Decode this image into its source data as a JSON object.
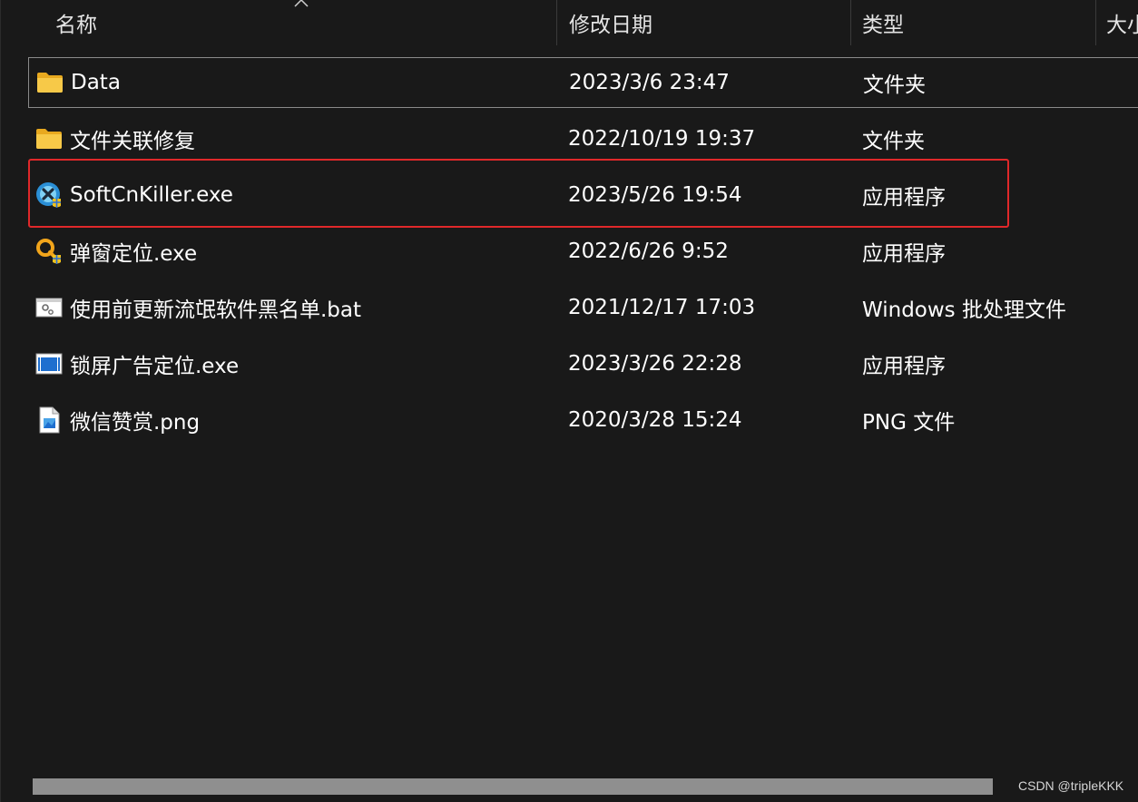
{
  "columns": {
    "name": "名称",
    "modified": "修改日期",
    "type": "类型",
    "size": "大小"
  },
  "files": [
    {
      "name": "Data",
      "modified": "2023/3/6 23:47",
      "type": "文件夹",
      "icon": "folder-icon"
    },
    {
      "name": "文件关联修复",
      "modified": "2022/10/19 19:37",
      "type": "文件夹",
      "icon": "folder-icon"
    },
    {
      "name": "SoftCnKiller.exe",
      "modified": "2023/5/26 19:54",
      "type": "应用程序",
      "icon": "softcnkiller-app-icon"
    },
    {
      "name": "弹窗定位.exe",
      "modified": "2022/6/26 9:52",
      "type": "应用程序",
      "icon": "popup-locator-app-icon"
    },
    {
      "name": "使用前更新流氓软件黑名单.bat",
      "modified": "2021/12/17 17:03",
      "type": "Windows 批处理文件",
      "icon": "batch-file-icon"
    },
    {
      "name": "锁屏广告定位.exe",
      "modified": "2023/3/26 22:28",
      "type": "应用程序",
      "icon": "window-app-icon"
    },
    {
      "name": "微信赞赏.png",
      "modified": "2020/3/28 15:24",
      "type": "PNG 文件",
      "icon": "png-file-icon"
    }
  ],
  "colors": {
    "background": "#191919",
    "highlight": "#e0282a",
    "folder": "#f5c542"
  },
  "watermark": "CSDN @tripleKKK"
}
